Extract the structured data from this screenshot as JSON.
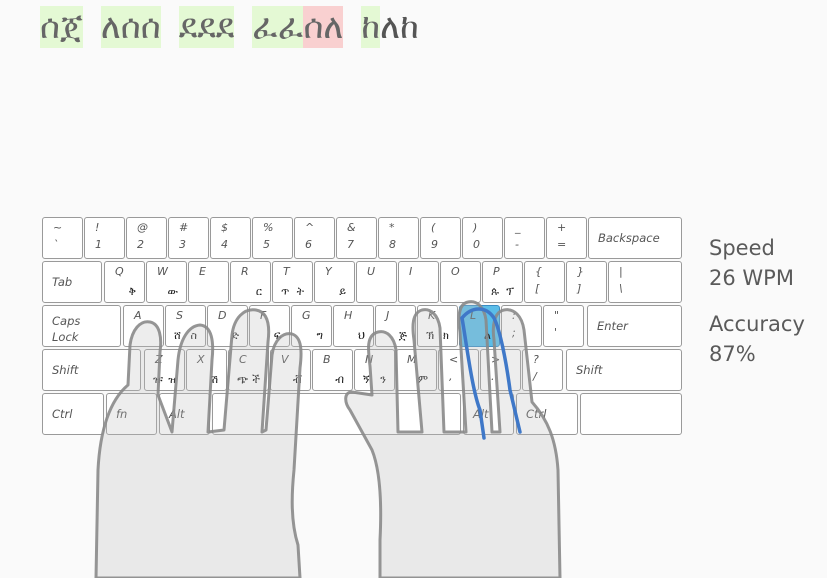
{
  "typing": {
    "words": [
      {
        "chars": [
          {
            "t": "ሰ",
            "s": "typed"
          },
          {
            "t": "ጀ",
            "s": "typed"
          }
        ]
      },
      {
        "chars": [
          {
            "t": "ለ",
            "s": "typed"
          },
          {
            "t": "ሰ",
            "s": "typed"
          },
          {
            "t": "ሰ",
            "s": "typed"
          }
        ]
      },
      {
        "chars": [
          {
            "t": "ደ",
            "s": "typed"
          },
          {
            "t": "ደ",
            "s": "typed"
          },
          {
            "t": "ደ",
            "s": "typed"
          }
        ]
      },
      {
        "chars": [
          {
            "t": "ፈ",
            "s": "typed"
          },
          {
            "t": "ፈ",
            "s": "typed"
          },
          {
            "t": "ሰ",
            "s": "err"
          },
          {
            "t": "ለ",
            "s": "err"
          }
        ]
      },
      {
        "chars": [
          {
            "t": "ከ",
            "s": "typed"
          },
          {
            "t": "ለ",
            "s": "pend"
          },
          {
            "t": "ከ",
            "s": "pend"
          }
        ]
      }
    ]
  },
  "keyboard": {
    "rows": [
      [
        {
          "name": "key-tilde",
          "shift": "~",
          "base": "`"
        },
        {
          "name": "key-1",
          "shift": "!",
          "base": "1"
        },
        {
          "name": "key-2",
          "shift": "@",
          "base": "2"
        },
        {
          "name": "key-3",
          "shift": "#",
          "base": "3"
        },
        {
          "name": "key-4",
          "shift": "$",
          "base": "4"
        },
        {
          "name": "key-5",
          "shift": "%",
          "base": "5"
        },
        {
          "name": "key-6",
          "shift": "^",
          "base": "6"
        },
        {
          "name": "key-7",
          "shift": "&",
          "base": "7"
        },
        {
          "name": "key-8",
          "shift": "*",
          "base": "8"
        },
        {
          "name": "key-9",
          "shift": "(",
          "base": "9"
        },
        {
          "name": "key-0",
          "shift": ")",
          "base": "0"
        },
        {
          "name": "key-minus",
          "shift": "_",
          "base": "-"
        },
        {
          "name": "key-equals",
          "shift": "+",
          "base": "="
        },
        {
          "name": "key-backspace",
          "label": "Backspace"
        }
      ],
      [
        {
          "name": "key-tab",
          "label": "Tab"
        },
        {
          "name": "key-q",
          "shift": "Q",
          "am_base": "ቅ"
        },
        {
          "name": "key-w",
          "shift": "W",
          "am_base": "ው"
        },
        {
          "name": "key-e",
          "shift": "E"
        },
        {
          "name": "key-r",
          "shift": "R",
          "am_base": "ር"
        },
        {
          "name": "key-t",
          "shift": "T",
          "am_shift": "ጥ",
          "am_base": "ት"
        },
        {
          "name": "key-y",
          "shift": "Y",
          "am_base": "ይ"
        },
        {
          "name": "key-u",
          "shift": "U"
        },
        {
          "name": "key-i",
          "shift": "I"
        },
        {
          "name": "key-o",
          "shift": "O"
        },
        {
          "name": "key-p",
          "shift": "P",
          "am_shift": "ጱ",
          "am_base": "ፕ"
        },
        {
          "name": "key-lbracket",
          "shift": "{",
          "base": "["
        },
        {
          "name": "key-rbracket",
          "shift": "}",
          "base": "]"
        },
        {
          "name": "key-backslash",
          "shift": "|",
          "base": "\\"
        }
      ],
      [
        {
          "name": "key-capslock",
          "label": "Caps Lock"
        },
        {
          "name": "key-a",
          "shift": "A"
        },
        {
          "name": "key-s",
          "shift": "S",
          "am_shift": "ሸ",
          "am_base": "ስ"
        },
        {
          "name": "key-d",
          "shift": "D",
          "am_base": "ድ"
        },
        {
          "name": "key-f",
          "shift": "F",
          "am_base": "ፍ"
        },
        {
          "name": "key-g",
          "shift": "G",
          "am_base": "ግ"
        },
        {
          "name": "key-h",
          "shift": "H",
          "am_base": "ህ"
        },
        {
          "name": "key-j",
          "shift": "J",
          "am_base": "ጅ"
        },
        {
          "name": "key-k",
          "shift": "K",
          "am_shift": "ኽ",
          "am_base": "ክ"
        },
        {
          "name": "key-l",
          "shift": "L",
          "am_base": "ል"
        },
        {
          "name": "key-semicolon",
          "shift": ":",
          "base": ";"
        },
        {
          "name": "key-quote",
          "shift": "\"",
          "base": "'"
        },
        {
          "name": "key-enter",
          "label": "Enter"
        }
      ],
      [
        {
          "name": "key-shift-left",
          "label": "Shift"
        },
        {
          "name": "key-z",
          "shift": "Z",
          "am_shift": "ዡ",
          "am_base": "ዝ"
        },
        {
          "name": "key-x",
          "shift": "X",
          "am_base": "ሽ"
        },
        {
          "name": "key-c",
          "shift": "C",
          "am_shift": "ጭ",
          "am_base": "ች"
        },
        {
          "name": "key-v",
          "shift": "V",
          "am_base": "ቭ"
        },
        {
          "name": "key-b",
          "shift": "B",
          "am_base": "ብ"
        },
        {
          "name": "key-n",
          "shift": "N",
          "am_shift": "ኝ",
          "am_base": "ን"
        },
        {
          "name": "key-m",
          "shift": "M",
          "am_base": "ም"
        },
        {
          "name": "key-comma",
          "shift": "<",
          "base": ","
        },
        {
          "name": "key-period",
          "shift": ">",
          "base": "."
        },
        {
          "name": "key-slash",
          "shift": "?",
          "base": "/"
        },
        {
          "name": "key-shift-right",
          "label": "Shift"
        }
      ],
      [
        {
          "name": "key-ctrl-left",
          "label": "Ctrl"
        },
        {
          "name": "key-fn",
          "label": "fn"
        },
        {
          "name": "key-alt-left",
          "label": "Alt"
        },
        {
          "name": "key-space",
          "label": ""
        },
        {
          "name": "key-alt-right",
          "label": "Alt"
        },
        {
          "name": "key-ctrl-right",
          "label": "Ctrl"
        },
        {
          "name": "key-blank-right",
          "label": ""
        }
      ]
    ],
    "active_key": "key-l",
    "active_color": "#5bbde8"
  },
  "stats": {
    "speed_label": "Speed",
    "speed_value": "26 WPM",
    "accuracy_label": "Accuracy",
    "accuracy_value": "87%"
  }
}
